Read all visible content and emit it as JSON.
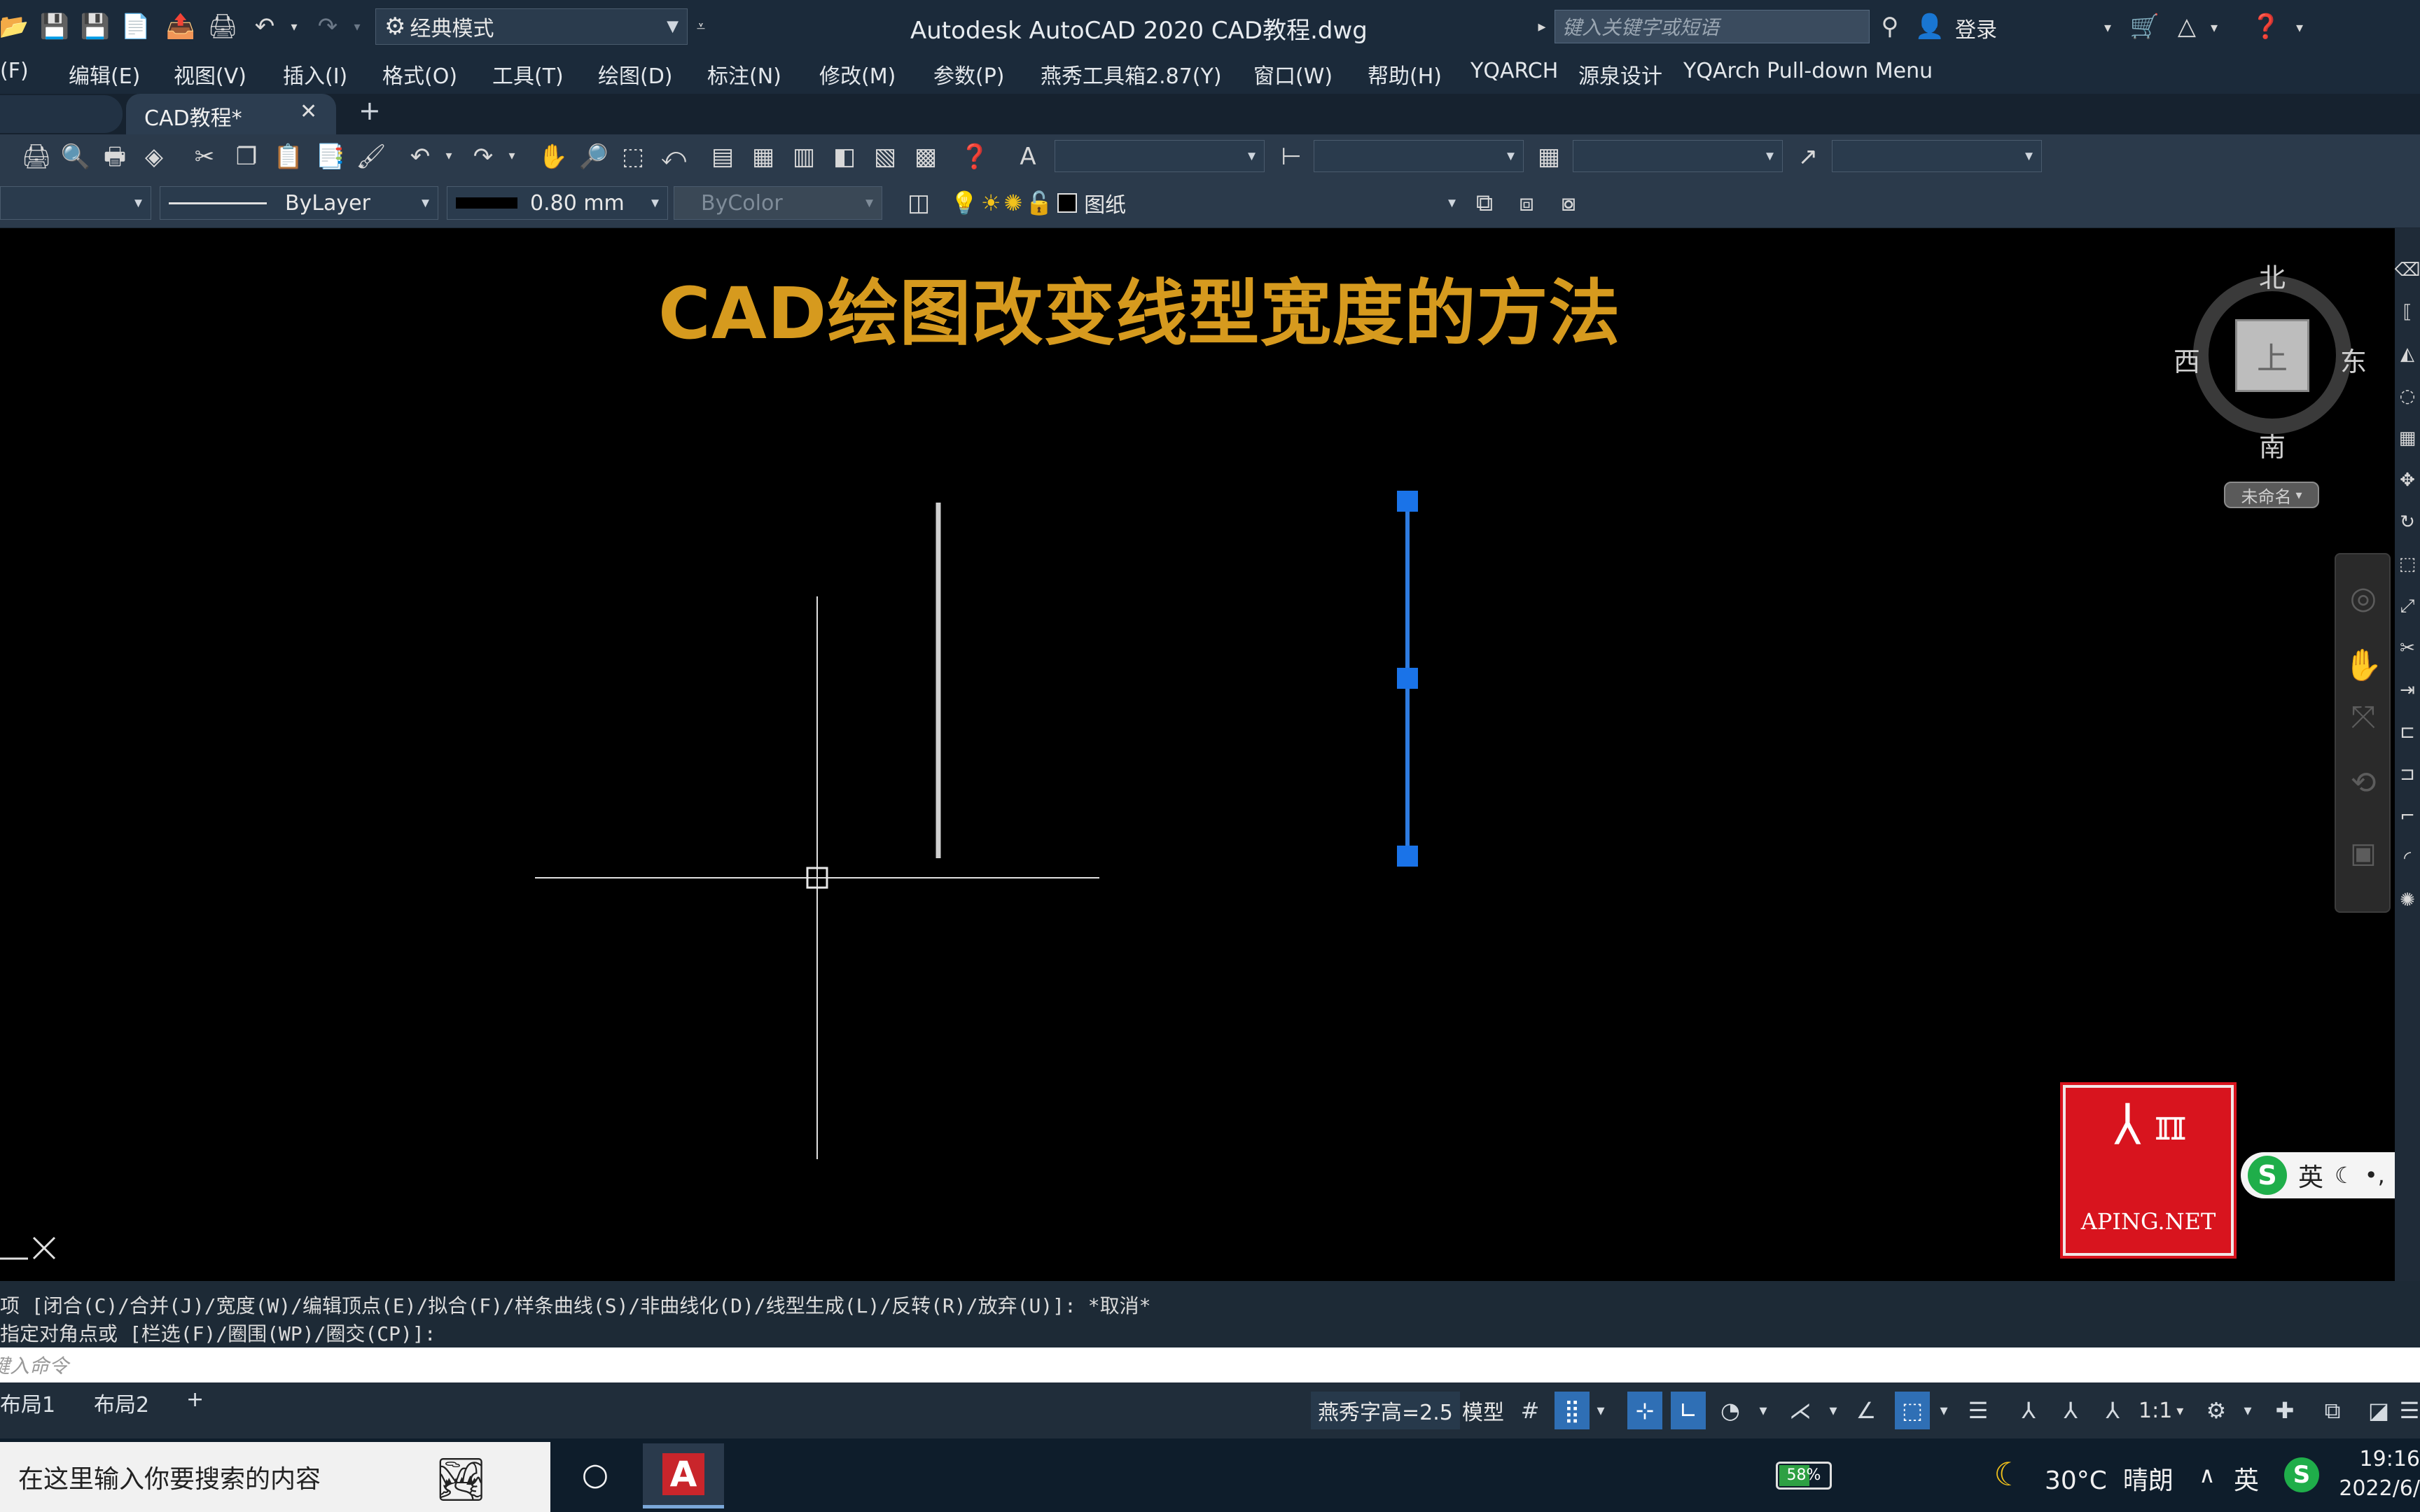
{
  "titlebar": {
    "workspace": "经典模式",
    "app_title": "Autodesk AutoCAD 2020    CAD教程.dwg",
    "search_placeholder": "键入关键字或短语",
    "login": "登录"
  },
  "menu": [
    "(F)",
    "编辑(E)",
    "视图(V)",
    "插入(I)",
    "格式(O)",
    "工具(T)",
    "绘图(D)",
    "标注(N)",
    "修改(M)",
    "参数(P)",
    "燕秀工具箱2.87(Y)",
    "窗口(W)",
    "帮助(H)",
    "YQARCH",
    "源泉设计",
    "YQArch Pull-down Menu"
  ],
  "tab": {
    "name": "CAD教程*",
    "close": "✕",
    "add": "+"
  },
  "properties": {
    "linetype": "ByLayer",
    "lineweight": "0.80 mm",
    "color": "ByColor",
    "layer": "图纸"
  },
  "canvas": {
    "heading": "CAD绘图改变线型宽度的方法",
    "heading_color": "#d69a1e",
    "viewcube": {
      "north": "北",
      "south": "南",
      "west": "西",
      "east": "东",
      "top": "上",
      "ucs": "未命名"
    }
  },
  "watermark": {
    "site": "APING.NET"
  },
  "ime": {
    "lang": "英"
  },
  "command": {
    "line1": "项 [闭合(C)/合并(J)/宽度(W)/编辑顶点(E)/拟合(F)/样条曲线(S)/非曲线化(D)/线型生成(L)/反转(R)/放弃(U)]: *取消*",
    "line2": "指定对角点或 [栏选(F)/圈围(WP)/圈交(CP)]:",
    "input_placeholder": "键入命令"
  },
  "layouts": [
    "布局1",
    "布局2",
    "+"
  ],
  "status": {
    "text_height": "燕秀字高=2.5",
    "model": "模型",
    "scale": "1:1"
  },
  "taskbar": {
    "search_placeholder": "在这里输入你要搜索的内容",
    "battery": "58%",
    "weather": "30°C  晴朗",
    "ime": "英",
    "time": "19:16",
    "date": "2022/6/"
  }
}
